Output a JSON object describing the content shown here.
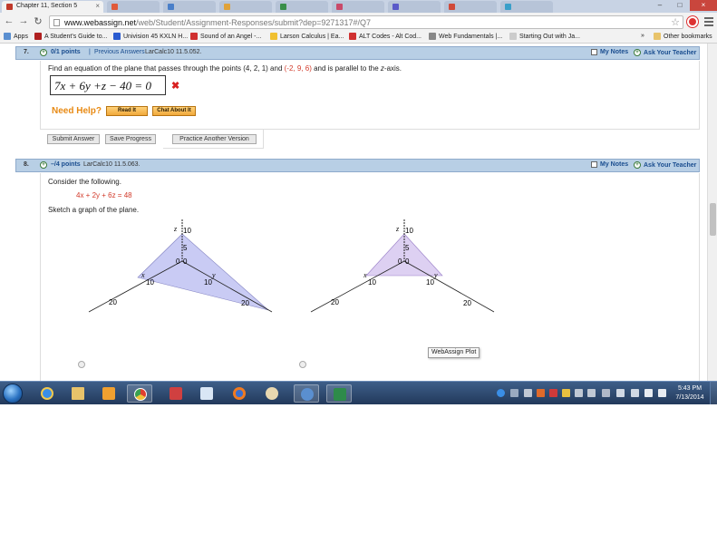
{
  "browser": {
    "active_tab_title": "Chapter 11, Section 5",
    "url_host": "www.webassign.net",
    "url_path": "/web/Student/Assignment-Responses/submit?dep=9271317#/Q7",
    "inactive_tab_colors": [
      "#e05a3a",
      "#4a7fc9",
      "#e0a23a",
      "#3a8f4a",
      "#c94a6a",
      "#5a5ac9",
      "#d04a3a",
      "#3a9fc9"
    ]
  },
  "bookmarks": [
    {
      "label": "Apps",
      "color": "#5a8fd0"
    },
    {
      "label": "A Student's Guide to...",
      "color": "#b02020"
    },
    {
      "label": "Univision 45 KXLN H...",
      "color": "#2a5bd0"
    },
    {
      "label": "Sound of an Angel -...",
      "color": "#d03030"
    },
    {
      "label": "Larson Calculus | Ea...",
      "color": "#f0c030"
    },
    {
      "label": "ALT Codes - Alt Cod...",
      "color": "#d03030"
    },
    {
      "label": "Web Fundamentals |...",
      "color": "#888888"
    },
    {
      "label": "Starting Out with Ja...",
      "color": "#cccccc"
    }
  ],
  "other_bookmarks": "Other bookmarks",
  "q7": {
    "number": "7.",
    "points": "0/1 points",
    "separator": "|",
    "previous_answers": "Previous Answers",
    "ref": "LarCalc10 11.5.052.",
    "my_notes": "My Notes",
    "ask_teacher": "Ask Your Teacher",
    "prompt_part1": "Find an equation of the plane that passes through the points (4, 2, 1) and ",
    "prompt_red": "(-2, 9, 6)",
    "prompt_part2": " and is parallel to the ",
    "prompt_axis": "z",
    "prompt_part3": "-axis.",
    "answer": "7x + 6y +z − 40 = 0",
    "wrong_mark": "✖",
    "need_help": "Need Help?",
    "read_it": "Read It",
    "chat_about_it": "Chat About It",
    "submit": "Submit Answer",
    "save": "Save Progress",
    "practice": "Practice Another Version"
  },
  "q8": {
    "number": "8.",
    "points": "–/4 points",
    "ref": "LarCalc10 11.5.063.",
    "my_notes": "My Notes",
    "ask_teacher": "Ask Your Teacher",
    "consider": "Consider the following.",
    "equation": "4x + 2y + 6z = 48",
    "sketch": "Sketch a graph of the plane.",
    "tooltip": "WebAssign Plot"
  },
  "plot_labels": {
    "z": "z",
    "x": "x",
    "y": "y",
    "ten": "10",
    "five": "5",
    "zero": "0",
    "twenty": "20"
  },
  "taskbar": {
    "time": "5:43 PM",
    "date": "7/13/2014"
  }
}
